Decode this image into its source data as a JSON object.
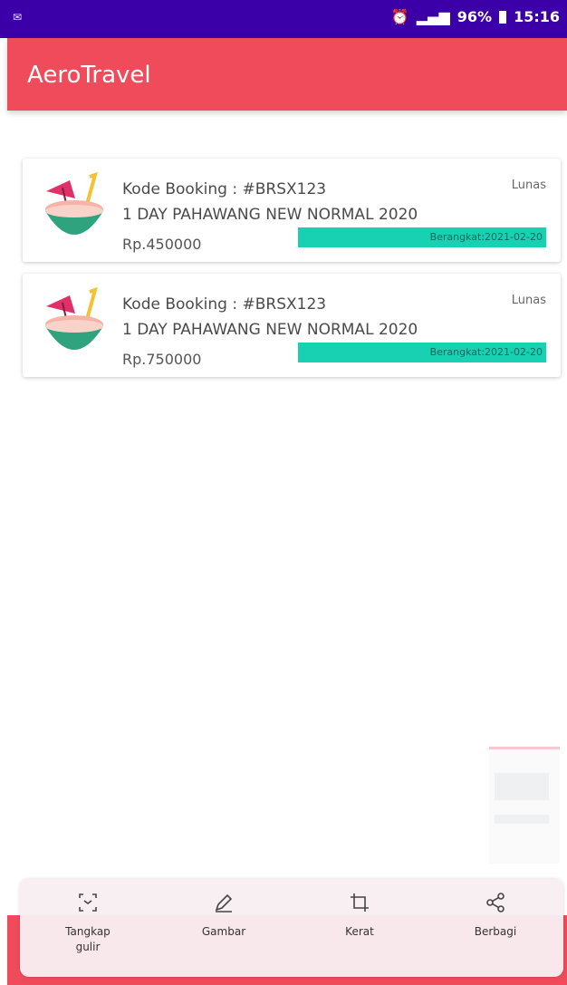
{
  "status_bar": {
    "left_icon": "mail-icon",
    "battery": "96%",
    "time": "15:16"
  },
  "app_bar": {
    "title": "AeroTravel"
  },
  "bookings": [
    {
      "code_line": "Kode Booking : #BRSX123",
      "package": "1 DAY PAHAWANG NEW NORMAL 2020",
      "price": "Rp.450000",
      "status": "Lunas",
      "departure": "Berangkat:2021-02-20"
    },
    {
      "code_line": "Kode Booking : #BRSX123",
      "package": "1 DAY PAHAWANG NEW NORMAL 2020",
      "price": "Rp.750000",
      "status": "Lunas",
      "departure": "Berangkat:2021-02-20"
    }
  ],
  "screenshot_toolbar": {
    "items": [
      {
        "label": "Tangkap gulir",
        "icon": "scroll-capture-icon"
      },
      {
        "label": "Gambar",
        "icon": "pen-icon"
      },
      {
        "label": "Kerat",
        "icon": "crop-icon"
      },
      {
        "label": "Berbagi",
        "icon": "share-icon"
      }
    ]
  },
  "colors": {
    "status_bar": "#3b00a8",
    "app_bar": "#ef4b5b",
    "departure_tag": "#18d1b3"
  }
}
